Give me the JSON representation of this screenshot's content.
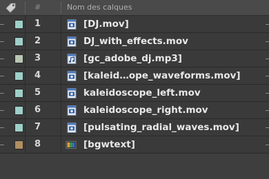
{
  "header": {
    "hash_label": "#",
    "name_column_label": "Nom des calques"
  },
  "colors": {
    "aqua": "#9ecfc8",
    "light_gray_green": "#b9c7b3",
    "tan": "#b08f62"
  },
  "layers": [
    {
      "number": "1",
      "name": "[DJ.mov]",
      "label_color": "#9ecfc8",
      "icon": "video-file-icon"
    },
    {
      "number": "2",
      "name": "DJ_with_effects.mov",
      "label_color": "#9ecfc8",
      "icon": "video-file-icon"
    },
    {
      "number": "3",
      "name": "[gc_adobe_dj.mp3]",
      "label_color": "#b9c7b3",
      "icon": "audio-file-icon"
    },
    {
      "number": "4",
      "name": "[kaleid…ope_waveforms.mov]",
      "label_color": "#9ecfc8",
      "icon": "video-file-icon"
    },
    {
      "number": "5",
      "name": "kaleidoscope_left.mov",
      "label_color": "#9ecfc8",
      "icon": "video-file-icon"
    },
    {
      "number": "6",
      "name": "kaleidoscope_right.mov",
      "label_color": "#9ecfc8",
      "icon": "video-file-icon"
    },
    {
      "number": "7",
      "name": "[pulsating_radial_waves.mov]",
      "label_color": "#9ecfc8",
      "icon": "video-file-icon"
    },
    {
      "number": "8",
      "name": "[bgwtext]",
      "label_color": "#b08f62",
      "icon": "composition-icon"
    }
  ]
}
